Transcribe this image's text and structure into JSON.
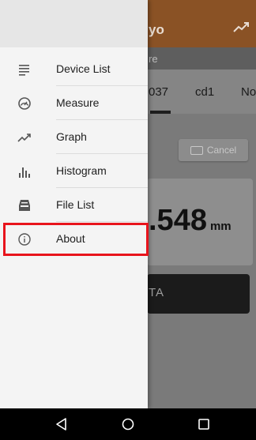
{
  "background_app": {
    "title": "yo",
    "subtitle": "re",
    "tabs": [
      "037",
      "cd1",
      "No"
    ],
    "cancel_label": "Cancel",
    "reading_value": ".548",
    "reading_unit": "mm",
    "action_label": "TA"
  },
  "drawer": {
    "items": [
      {
        "label": "Device List",
        "icon": "list-icon"
      },
      {
        "label": "Measure",
        "icon": "gauge-icon"
      },
      {
        "label": "Graph",
        "icon": "trending-up-icon"
      },
      {
        "label": "Histogram",
        "icon": "bar-chart-icon"
      },
      {
        "label": "File List",
        "icon": "inbox-icon"
      },
      {
        "label": "About",
        "icon": "info-icon",
        "highlighted": true
      }
    ]
  },
  "colors": {
    "highlight": "#e8141c",
    "app_bar": "#8a5225"
  },
  "navbar": {
    "buttons": [
      "back-icon",
      "home-icon",
      "recents-icon"
    ]
  }
}
